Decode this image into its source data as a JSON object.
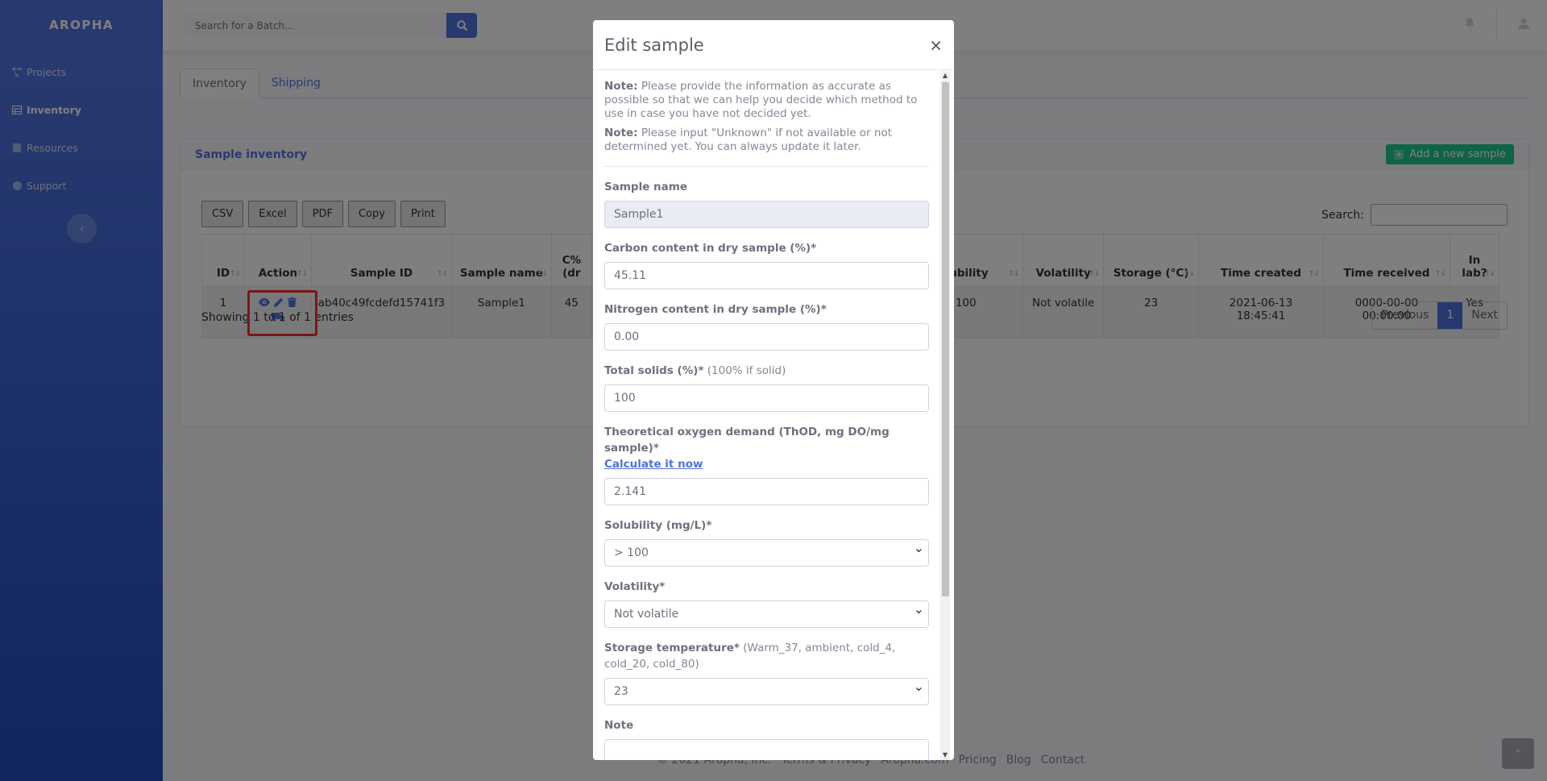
{
  "app": {
    "brand": "AROPHA"
  },
  "sidebar": {
    "items": [
      {
        "label": "Projects",
        "icon": "project-diagram-icon"
      },
      {
        "label": "Inventory",
        "icon": "table-icon"
      },
      {
        "label": "Resources",
        "icon": "book-icon"
      },
      {
        "label": "Support",
        "icon": "info-circle-icon"
      }
    ],
    "toggle_icon": "chevron-left-icon"
  },
  "topbar": {
    "search_placeholder": "Search for a Batch..."
  },
  "tabs": [
    {
      "label": "Inventory"
    },
    {
      "label": "Shipping"
    }
  ],
  "card": {
    "title": "Sample inventory",
    "add_button": "Add a new sample",
    "export_buttons": [
      "CSV",
      "Excel",
      "PDF",
      "Copy",
      "Print"
    ],
    "search_label": "Search:",
    "columns": {
      "id": "ID",
      "action": "Action",
      "sample_id": "Sample ID",
      "sample_name": "Sample name",
      "carbon": "C% (dr",
      "solubility": "ubility",
      "volatility": "Volatility",
      "storage": "Storage (°C)",
      "time_created": "Time created",
      "time_received": "Time received",
      "in_lab": "In lab?"
    },
    "row": {
      "id": "1",
      "sample_id": "ab40c49fcdefd15741f3",
      "sample_name": "Sample1",
      "carbon": "45",
      "solubility": "> 100",
      "volatility": "Not volatile",
      "storage": "23",
      "time_created": "2021-06-13 18:45:41",
      "time_received": "0000-00-00 00:00:00",
      "in_lab": "Yes"
    },
    "info": "Showing 1 to 1 of 1 entries",
    "pagination": {
      "previous": "Previous",
      "current": "1",
      "next": "Next"
    }
  },
  "footer": {
    "copyright": "© 2021 Aropha, Inc.",
    "links": [
      "Terms & Privacy",
      "Aropha.com",
      "Pricing",
      "Blog",
      "Contact"
    ]
  },
  "modal": {
    "title": "Edit sample",
    "note1_bold": "Note:",
    "note1_text": " Please provide the information as accurate as possible so that we can help you decide which method to use in case you have not decided yet.",
    "note2_bold": "Note:",
    "note2_text": " Please input \"Unknown\" if not available or not determined yet. You can always update it later.",
    "fields": {
      "sample_name": {
        "label": "Sample name",
        "value": "Sample1"
      },
      "carbon": {
        "label": "Carbon content in dry sample (%)*",
        "value": "45.11"
      },
      "nitrogen": {
        "label": "Nitrogen content in dry sample (%)*",
        "value": "0.00"
      },
      "solids": {
        "label": "Total solids (%)*",
        "hint": " (100% if solid)",
        "value": "100"
      },
      "thod": {
        "label": "Theoretical oxygen demand (ThOD, mg DO/mg sample)*",
        "link": "Calculate it now",
        "value": "2.141"
      },
      "solubility": {
        "label": "Solubility (mg/L)*",
        "value": "> 100"
      },
      "volatility": {
        "label": "Volatility*",
        "value": "Not volatile"
      },
      "storage": {
        "label": "Storage temperature*",
        "hint": " (Warm_37, ambient, cold_4, cold_20, cold_80)",
        "value": "23"
      },
      "note": {
        "label": "Note",
        "value": ""
      }
    }
  },
  "colors": {
    "primary": "#4e73df",
    "success": "#1cc88a",
    "highlight": "#ff2a2a"
  }
}
